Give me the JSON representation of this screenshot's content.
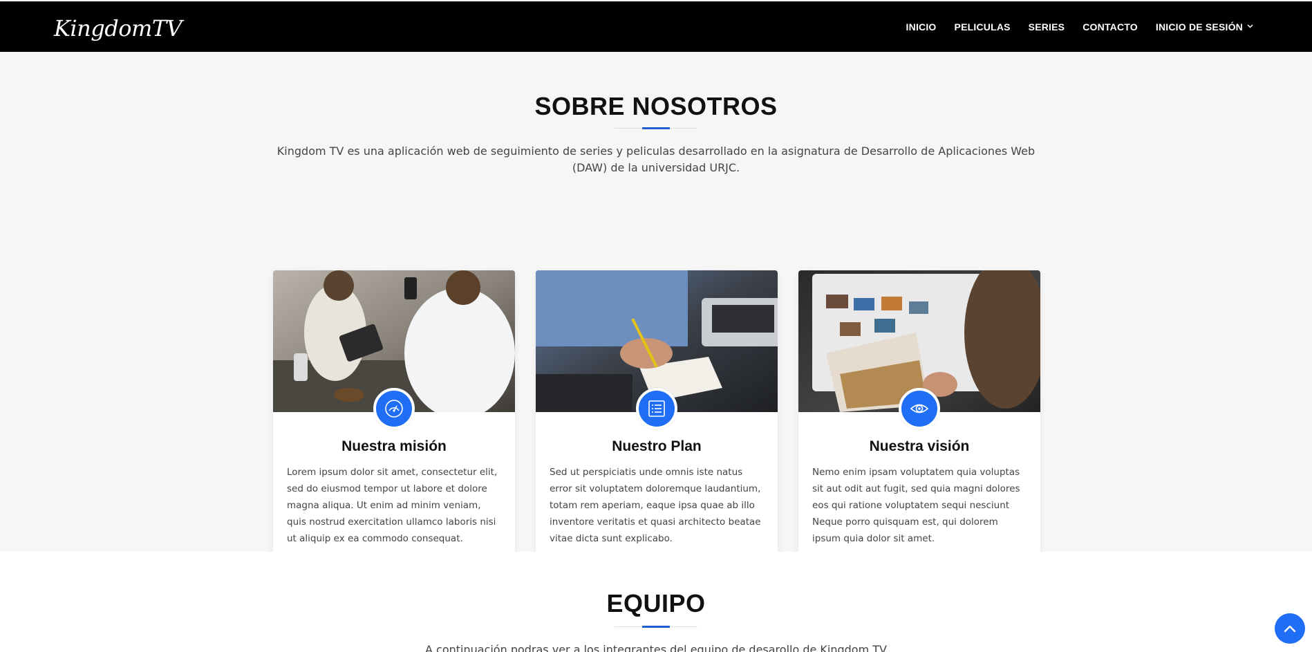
{
  "header": {
    "logo": "KingdomTV",
    "nav": [
      {
        "label": "INICIO"
      },
      {
        "label": "PELICULAS"
      },
      {
        "label": "SERIES"
      },
      {
        "label": "CONTACTO"
      },
      {
        "label": "INICIO DE SESIÓN"
      }
    ]
  },
  "about": {
    "title": "SOBRE NOSOTROS",
    "lead": "Kingdom TV es una aplicación web de seguimiento de series y peliculas desarrollado en la asignatura de Desarrollo de Aplicaciones Web (DAW) de la universidad URJC.",
    "cards": [
      {
        "title": "Nuestra misión",
        "icon": "speedometer-icon",
        "text": "Lorem ipsum dolor sit amet, consectetur elit, sed do eiusmod tempor ut labore et dolore magna aliqua. Ut enim ad minim veniam, quis nostrud exercitation ullamco laboris nisi ut aliquip ex ea commodo consequat."
      },
      {
        "title": "Nuestro Plan",
        "icon": "list-icon",
        "text": "Sed ut perspiciatis unde omnis iste natus error sit voluptatem doloremque laudantium, totam rem aperiam, eaque ipsa quae ab illo inventore veritatis et quasi architecto beatae vitae dicta sunt explicabo."
      },
      {
        "title": "Nuestra visión",
        "icon": "eye-icon",
        "text": "Nemo enim ipsam voluptatem quia voluptas sit aut odit aut fugit, sed quia magni dolores eos qui ratione voluptatem sequi nesciunt Neque porro quisquam est, qui dolorem ipsum quia dolor sit amet."
      }
    ]
  },
  "team": {
    "title": "EQUIPO",
    "lead": "A continuación podras ver a los integrantes del equipo de desarollo de Kingdom TV"
  },
  "colors": {
    "accent": "#1f6ef5",
    "header_bg": "#000000",
    "section_bg": "#f6f6f6"
  }
}
